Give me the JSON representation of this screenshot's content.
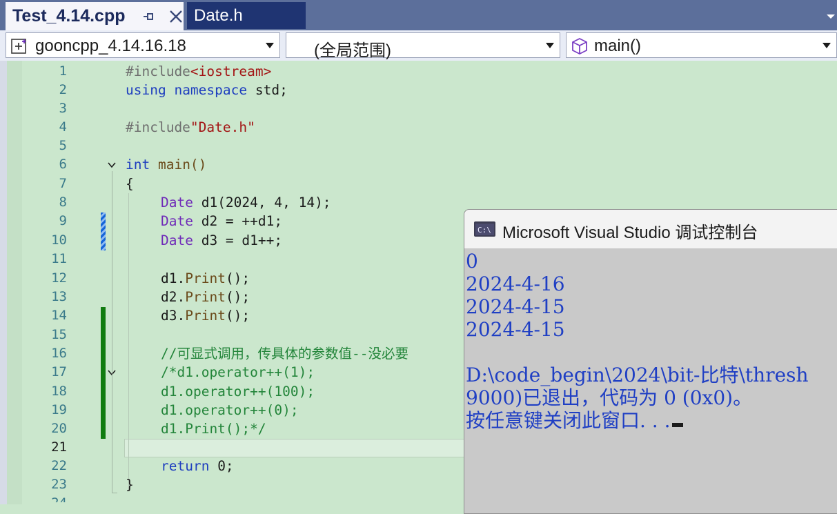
{
  "tabs": [
    {
      "label": "Test_4.14.cpp",
      "active": true
    },
    {
      "label": "Date.h",
      "active": false
    }
  ],
  "navbar": {
    "project": "gooncpp_4.14.16.18",
    "scope": "(全局范围)",
    "member": "main()"
  },
  "editor": {
    "line_numbers": [
      "1",
      "2",
      "3",
      "4",
      "5",
      "6",
      "7",
      "8",
      "9",
      "10",
      "11",
      "12",
      "13",
      "14",
      "15",
      "16",
      "17",
      "18",
      "19",
      "20",
      "21",
      "22",
      "23",
      "24"
    ],
    "current_line": "21",
    "lines": {
      "l1": {
        "pp": "#include",
        "str": "<iostream>"
      },
      "l2": {
        "kw1": "using",
        "kw2": "namespace",
        "rest": " std;"
      },
      "l4": {
        "pp": "#include",
        "str": "\"Date.h\""
      },
      "l6": {
        "kw": "int",
        "rest": " main()"
      },
      "l7": "{",
      "l8": {
        "type": "Date",
        "rest": " d1(2024, 4, 14);"
      },
      "l9": {
        "type": "Date",
        "rest": " d2 = ++d1;"
      },
      "l10": {
        "type": "Date",
        "rest": " d3 = d1++;"
      },
      "l12": {
        "obj": "d1.",
        "fn": "Print",
        "rest": "();"
      },
      "l13": {
        "obj": "d2.",
        "fn": "Print",
        "rest": "();"
      },
      "l14": {
        "obj": "d3.",
        "fn": "Print",
        "rest": "();"
      },
      "l16": "//可显式调用，传具体的参数值--没必要",
      "l17": "/*d1.operator++(1);",
      "l18": "d1.operator++(100);",
      "l19": "d1.operator++(0);",
      "l20": "d1.Print();*/",
      "l22": {
        "kw": "return",
        "rest": " 0;"
      },
      "l23": "}"
    }
  },
  "console": {
    "title": "Microsoft Visual Studio 调试控制台",
    "lines": [
      "0",
      "2024-4-16",
      "2024-4-15",
      "2024-4-15",
      "",
      "D:\\code_begin\\2024\\bit-比特\\thresh",
      "9000)已退出，代码为 0 (0x0)。",
      "按任意键关闭此窗口. . ."
    ]
  },
  "colors": {
    "editor_bg": "#cbe7cd",
    "keyword": "#1f3fbf",
    "type": "#6f2ab8",
    "string": "#a31515",
    "comment": "#23853a",
    "console_text": "#1f3fc4",
    "tab_active_bg": "#f5f5fa",
    "tab_inactive_bg": "#1f3472"
  }
}
